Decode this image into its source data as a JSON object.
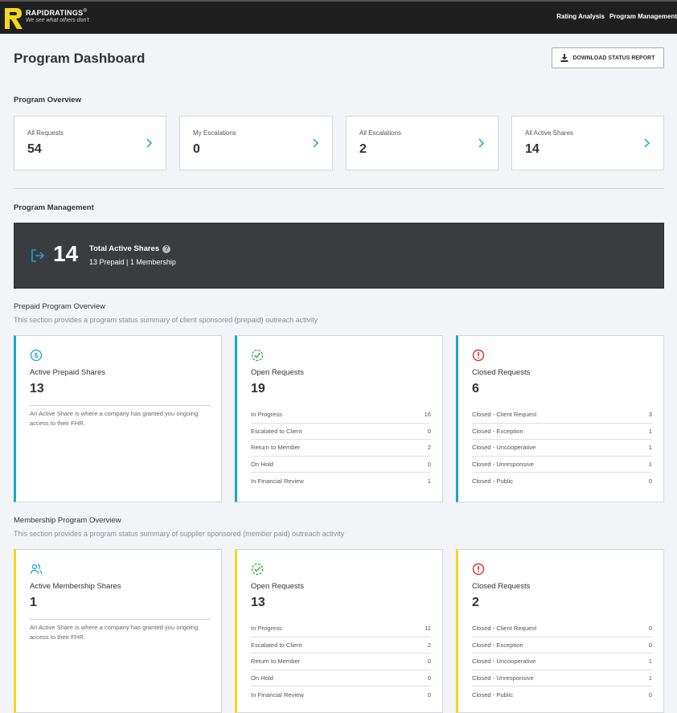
{
  "header": {
    "brand_name": "RAPIDRATINGS",
    "brand_reg": "®",
    "tagline": "We see what others don't",
    "nav": [
      "Rating Analysis",
      "Program Management"
    ]
  },
  "page": {
    "title": "Program Dashboard",
    "download_label": "DOWNLOAD STATUS REPORT"
  },
  "overview": {
    "heading": "Program Overview",
    "cards": [
      {
        "label": "All Requests",
        "value": "54"
      },
      {
        "label": "My Escalations",
        "value": "0"
      },
      {
        "label": "All Escalations",
        "value": "2"
      },
      {
        "label": "All Active Shares",
        "value": "14"
      }
    ]
  },
  "management": {
    "heading": "Program Management",
    "total_value": "14",
    "total_label": "Total Active Shares",
    "breakdown": "13 Prepaid | 1 Membership"
  },
  "prepaid": {
    "title": "Prepaid Program Overview",
    "description": "This section provides a program status summary of client sponsored (prepaid) outreach activity",
    "active": {
      "icon": "dollar-circle-icon",
      "title": "Active Prepaid Shares",
      "value": "13",
      "description": "An Active Share is where a company has granted you ongoing access to their FHR."
    },
    "open": {
      "icon": "check-circle-icon",
      "title": "Open Requests",
      "value": "19",
      "rows": [
        {
          "label": "In Progress",
          "value": "16"
        },
        {
          "label": "Escalated to Client",
          "value": "0"
        },
        {
          "label": "Return to Member",
          "value": "2"
        },
        {
          "label": "On Hold",
          "value": "0"
        },
        {
          "label": "In Financial Review",
          "value": "1"
        }
      ]
    },
    "closed": {
      "icon": "alert-circle-icon",
      "title": "Closed Requests",
      "value": "6",
      "rows": [
        {
          "label": "Closed - Client Request",
          "value": "3"
        },
        {
          "label": "Closed - Exception",
          "value": "1"
        },
        {
          "label": "Closed - Uncooperative",
          "value": "1"
        },
        {
          "label": "Closed - Unresponsive",
          "value": "1"
        },
        {
          "label": "Closed - Public",
          "value": "0"
        }
      ]
    }
  },
  "membership": {
    "title": "Membership Program Overview",
    "description": "This section provides a program status summary of supplier sponsored (member paid) outreach activity",
    "active": {
      "icon": "users-icon",
      "title": "Active Membership Shares",
      "value": "1",
      "description": "An Active Share is where a company has granted you ongoing access to their FHR."
    },
    "open": {
      "icon": "check-circle-icon",
      "title": "Open Requests",
      "value": "13",
      "rows": [
        {
          "label": "In Progress",
          "value": "11"
        },
        {
          "label": "Escalated to Client",
          "value": "2"
        },
        {
          "label": "Return to Member",
          "value": "0"
        },
        {
          "label": "On Hold",
          "value": "0"
        },
        {
          "label": "In Financial Review",
          "value": "0"
        }
      ]
    },
    "closed": {
      "icon": "alert-circle-icon",
      "title": "Closed Requests",
      "value": "2",
      "rows": [
        {
          "label": "Closed - Client Request",
          "value": "0"
        },
        {
          "label": "Closed - Exception",
          "value": "0"
        },
        {
          "label": "Closed - Uncooperative",
          "value": "1"
        },
        {
          "label": "Closed - Unresponsive",
          "value": "1"
        },
        {
          "label": "Closed - Public",
          "value": "0"
        }
      ]
    }
  },
  "colors": {
    "accent_blue": "#18a6c9",
    "accent_yellow": "#f5d81b",
    "check_green": "#3fae49",
    "alert_red": "#d9312b",
    "banner_dark": "#3a3d3f",
    "topbar": "#1f1f1f"
  }
}
